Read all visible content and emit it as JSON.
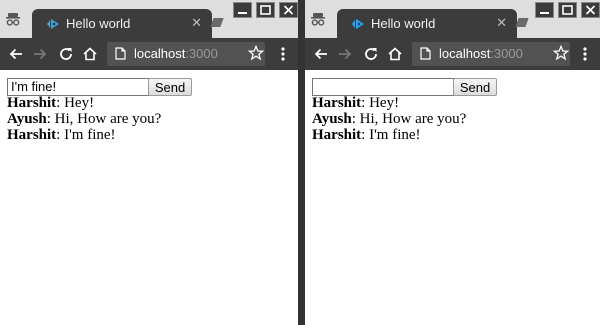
{
  "windows": [
    {
      "tab_title": "Hello world",
      "url_host": "localhost",
      "url_port": ":3000",
      "input_value": "I'm fine!",
      "input_placeholder": "",
      "send_label": "Send",
      "messages": [
        {
          "author": "Harshit",
          "text": "Hey!"
        },
        {
          "author": "Ayush",
          "text": "Hi, How are you?"
        },
        {
          "author": "Harshit",
          "text": "I'm fine!"
        }
      ]
    },
    {
      "tab_title": "Hello world",
      "url_host": "localhost",
      "url_port": ":3000",
      "input_value": "",
      "input_placeholder": "",
      "send_label": "Send",
      "messages": [
        {
          "author": "Harshit",
          "text": "Hey!"
        },
        {
          "author": "Ayush",
          "text": "Hi, How are you?"
        },
        {
          "author": "Harshit",
          "text": "I'm fine!"
        }
      ]
    }
  ],
  "message_separator": ": ",
  "icons": {
    "incognito": "incognito-icon",
    "favicon": "favicon-icon",
    "tab_close": "close-icon",
    "back": "back-arrow-icon",
    "forward": "forward-arrow-icon",
    "reload": "reload-icon",
    "home": "home-icon",
    "page_info": "page-info-icon",
    "bookmark": "star-icon",
    "menu": "kebab-menu-icon",
    "minimize": "minimize-icon",
    "maximize": "maximize-icon",
    "window_close": "window-close-icon"
  },
  "colors": {
    "titlebar": "#dedede",
    "tab": "#3c3c3c",
    "toolbar": "#3c3c3c",
    "omnibox": "#525252",
    "favicon": "#2fa6f0"
  }
}
